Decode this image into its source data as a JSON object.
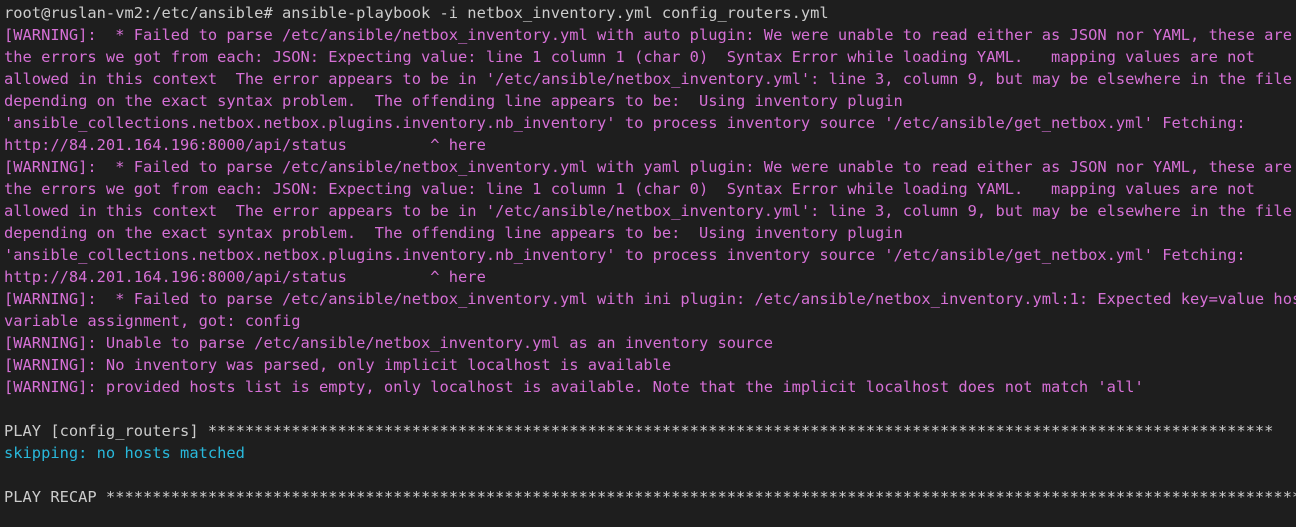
{
  "colors": {
    "background": "#1e1e1e",
    "normal": "#cccccc",
    "warning": "#d670d6",
    "skipping": "#29b8db"
  },
  "lines": [
    {
      "text": "root@ruslan-vm2:/etc/ansible# ansible-playbook -i netbox_inventory.yml config_routers.yml",
      "style": "normal"
    },
    {
      "text": "[WARNING]:  * Failed to parse /etc/ansible/netbox_inventory.yml with auto plugin: We were unable to read either as JSON nor YAML, these are",
      "style": "warn"
    },
    {
      "text": "the errors we got from each: JSON: Expecting value: line 1 column 1 (char 0)  Syntax Error while loading YAML.   mapping values are not",
      "style": "warn"
    },
    {
      "text": "allowed in this context  The error appears to be in '/etc/ansible/netbox_inventory.yml': line 3, column 9, but may be elsewhere in the file",
      "style": "warn"
    },
    {
      "text": "depending on the exact syntax problem.  The offending line appears to be:  Using inventory plugin",
      "style": "warn"
    },
    {
      "text": "'ansible_collections.netbox.netbox.plugins.inventory.nb_inventory' to process inventory source '/etc/ansible/get_netbox.yml' Fetching:",
      "style": "warn"
    },
    {
      "text": "http://84.201.164.196:8000/api/status         ^ here",
      "style": "warn"
    },
    {
      "text": "[WARNING]:  * Failed to parse /etc/ansible/netbox_inventory.yml with yaml plugin: We were unable to read either as JSON nor YAML, these are",
      "style": "warn"
    },
    {
      "text": "the errors we got from each: JSON: Expecting value: line 1 column 1 (char 0)  Syntax Error while loading YAML.   mapping values are not",
      "style": "warn"
    },
    {
      "text": "allowed in this context  The error appears to be in '/etc/ansible/netbox_inventory.yml': line 3, column 9, but may be elsewhere in the file",
      "style": "warn"
    },
    {
      "text": "depending on the exact syntax problem.  The offending line appears to be:  Using inventory plugin",
      "style": "warn"
    },
    {
      "text": "'ansible_collections.netbox.netbox.plugins.inventory.nb_inventory' to process inventory source '/etc/ansible/get_netbox.yml' Fetching:",
      "style": "warn"
    },
    {
      "text": "http://84.201.164.196:8000/api/status         ^ here",
      "style": "warn"
    },
    {
      "text": "[WARNING]:  * Failed to parse /etc/ansible/netbox_inventory.yml with ini plugin: /etc/ansible/netbox_inventory.yml:1: Expected key=value host",
      "style": "warn"
    },
    {
      "text": "variable assignment, got: config",
      "style": "warn"
    },
    {
      "text": "[WARNING]: Unable to parse /etc/ansible/netbox_inventory.yml as an inventory source",
      "style": "warn"
    },
    {
      "text": "[WARNING]: No inventory was parsed, only implicit localhost is available",
      "style": "warn"
    },
    {
      "text": "[WARNING]: provided hosts list is empty, only localhost is available. Note that the implicit localhost does not match 'all'",
      "style": "warn"
    },
    {
      "text": "",
      "style": "blank"
    },
    {
      "text": "PLAY [config_routers] *******************************************************************************************************************",
      "style": "normal"
    },
    {
      "text": "skipping: no hosts matched",
      "style": "skip"
    },
    {
      "text": "",
      "style": "blank"
    },
    {
      "text": "PLAY RECAP **********************************************************************************************************************************",
      "style": "normal"
    }
  ]
}
